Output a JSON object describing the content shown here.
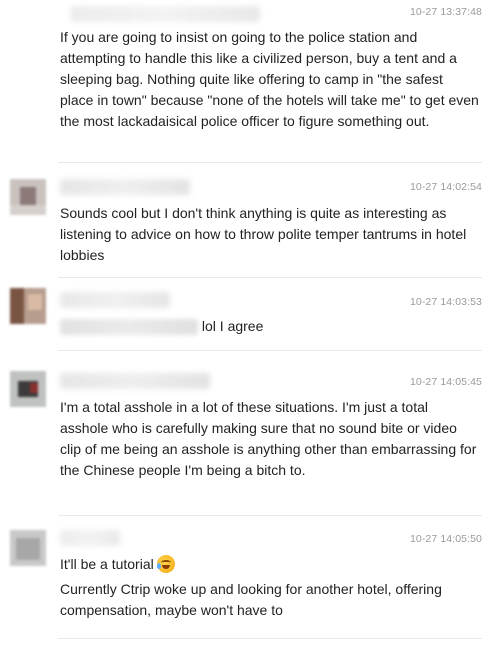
{
  "comments": [
    {
      "timestamp": "10-27 13:37:48",
      "text": "If you are going to insist on going to the police station and attempting to handle this like a civilized person, buy a tent and a sleeping bag. Nothing quite like offering to camp in \"the safest place in town\" because \"none of the hotels will take me\" to get even the most lackadaisical police officer to figure something out."
    },
    {
      "timestamp": "10-27 14:02:54",
      "text": "Sounds cool but I don't think anything is quite as interesting as listening to advice on how to throw polite temper tantrums in hotel lobbies"
    },
    {
      "timestamp": "10-27 14:03:53",
      "text": "lol I agree"
    },
    {
      "timestamp": "10-27 14:05:45",
      "text": "I'm a total asshole in a lot of these situations. I'm just a total asshole who is carefully making sure that no sound bite or video clip of me being an asshole is anything other than embarrassing for the Chinese people I'm being a bitch to."
    },
    {
      "timestamp": "10-27 14:05:50",
      "text_line1": "It'll be a tutorial",
      "emoji": "crying-laughing-emoji",
      "text_rest": "Currently Ctrip woke up and looking for another hotel, offering compensation, maybe won't have to"
    }
  ]
}
